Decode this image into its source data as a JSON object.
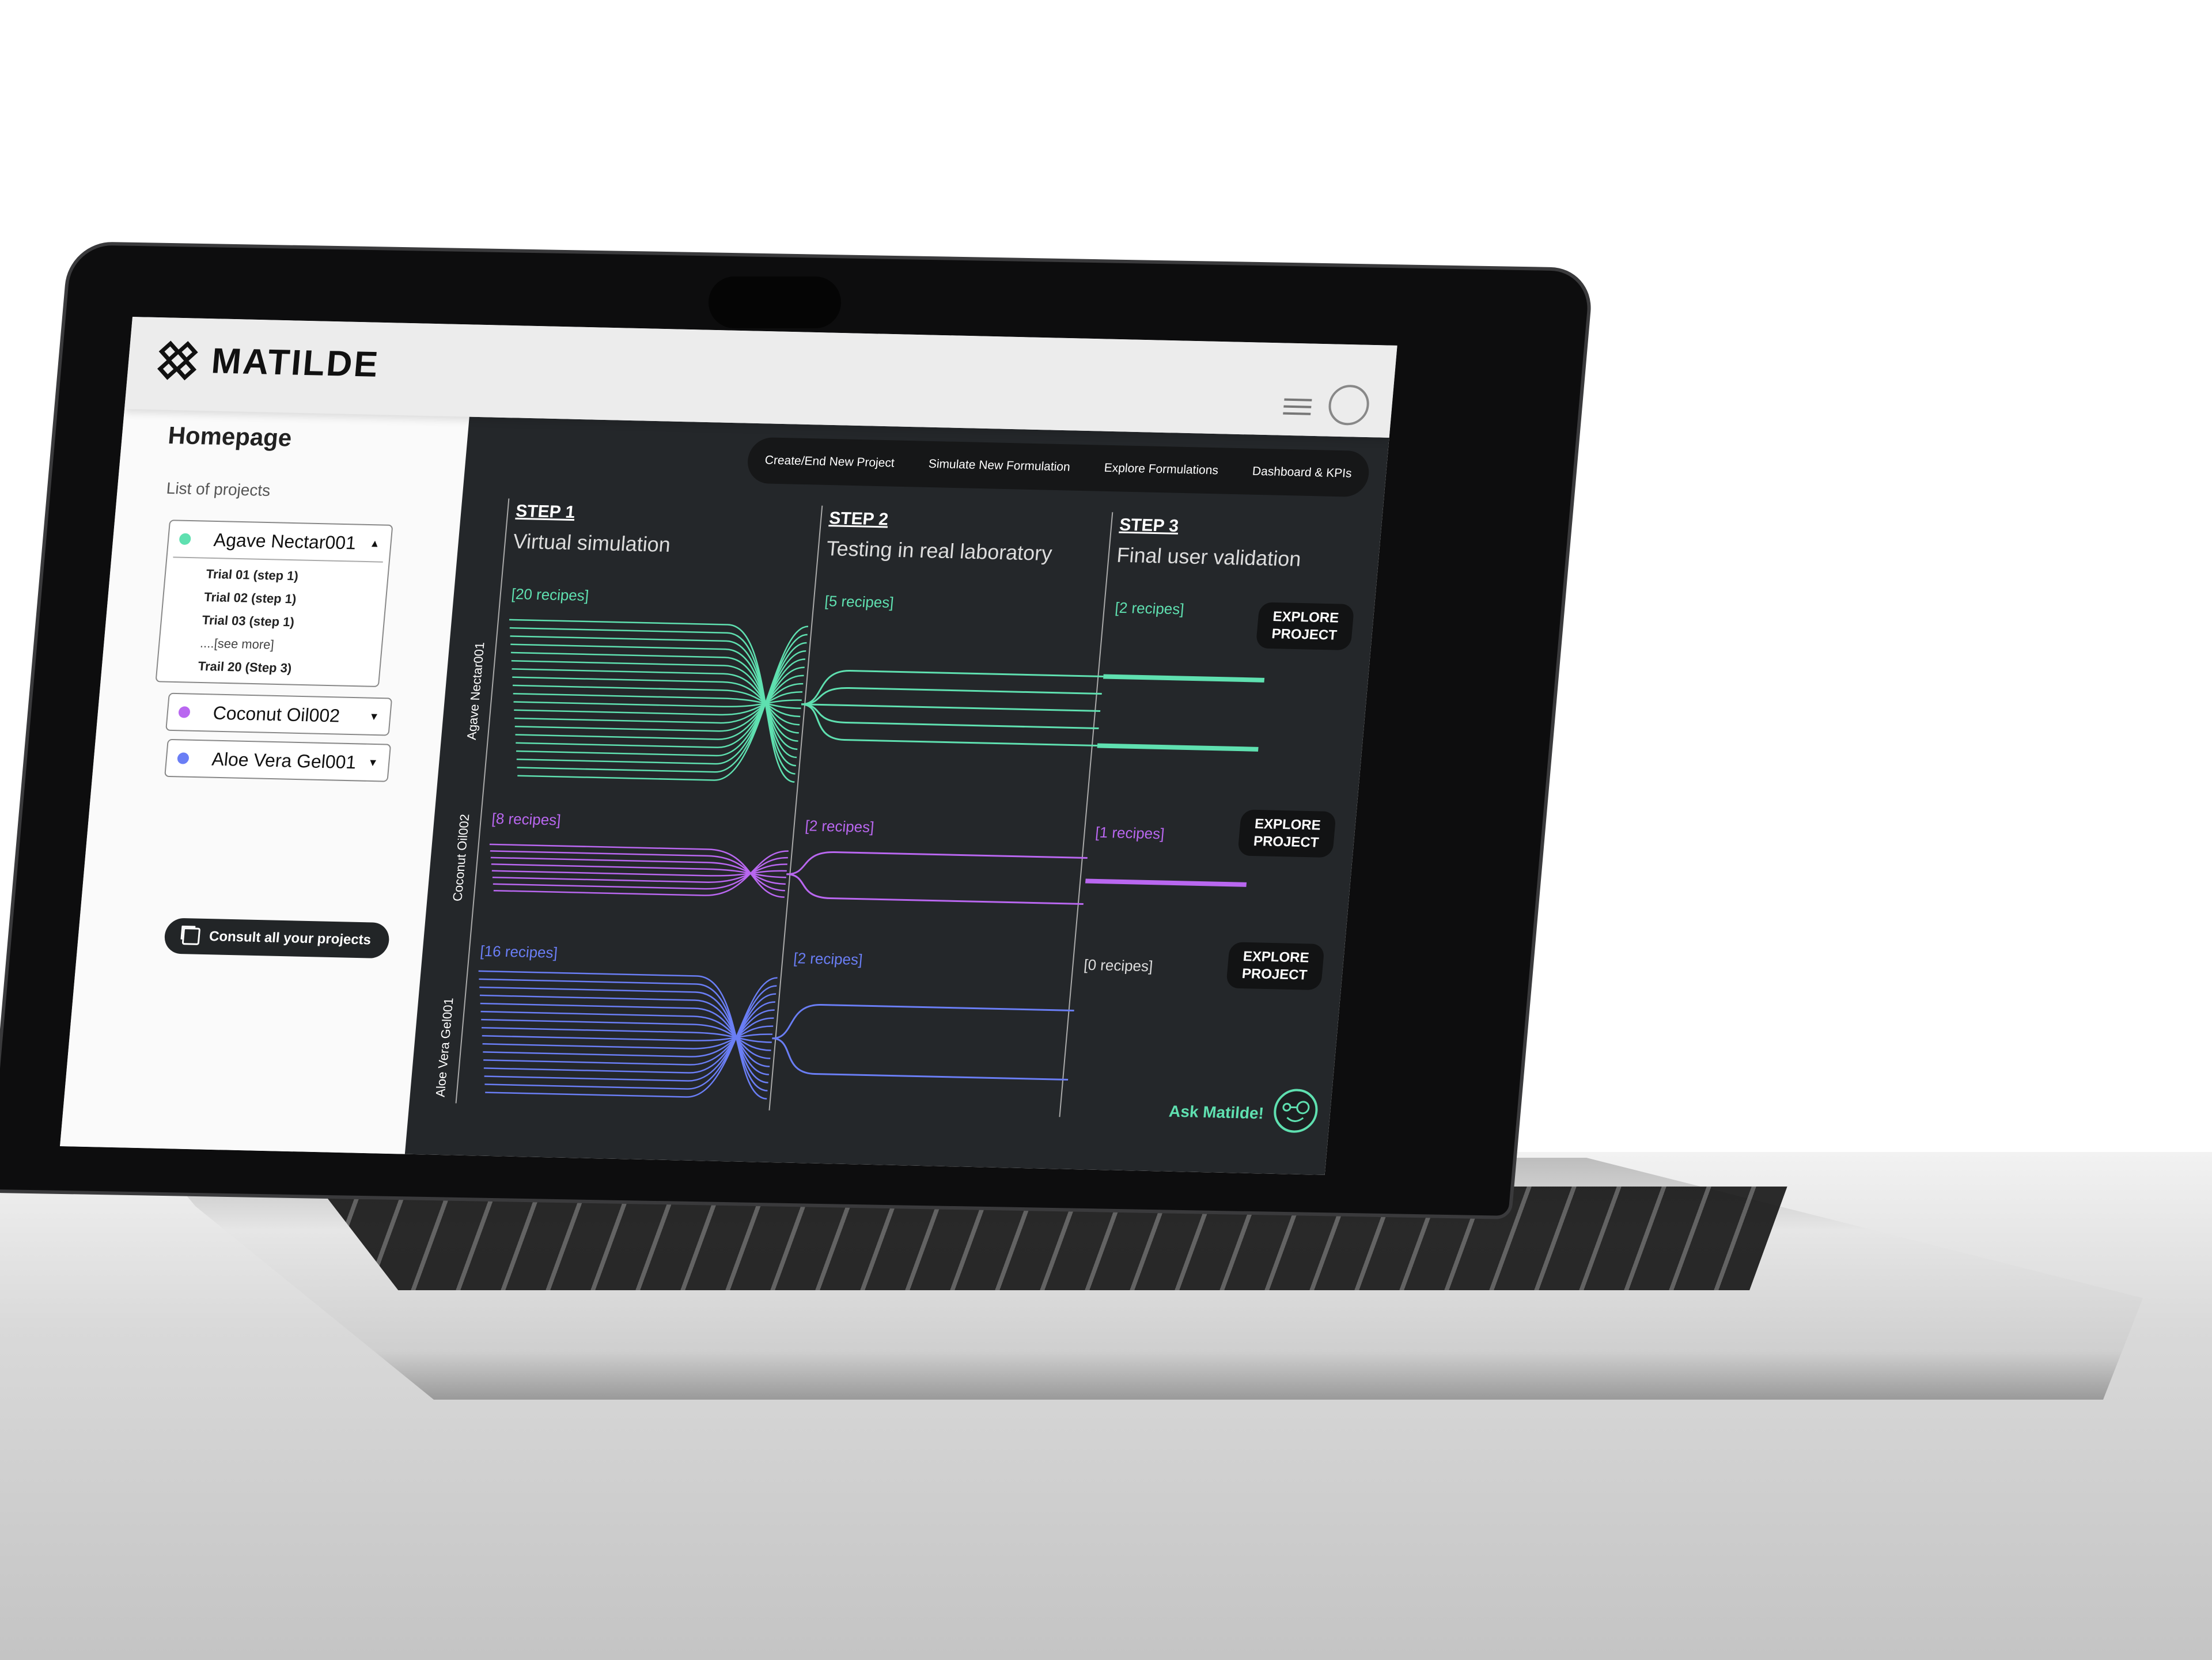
{
  "header": {
    "brand": "MATILDE",
    "icons": [
      "matilde-logo-icon",
      "hamburger-menu-icon",
      "user-profile-icon"
    ]
  },
  "sidebar": {
    "title": "Homepage",
    "list_label": "List of projects",
    "projects": [
      {
        "name": "Agave Nectar001",
        "color": "#5fe0b0",
        "expanded": true,
        "items": [
          "Trial 01 (step 1)",
          "Trial 02 (step 1)",
          "Trial 03 (step 1)",
          "....[see more]",
          "Trail 20 (Step 3)"
        ]
      },
      {
        "name": "Coconut Oil002",
        "color": "#b967f0",
        "expanded": false
      },
      {
        "name": "Aloe Vera Gel001",
        "color": "#6a7ef5",
        "expanded": false
      }
    ],
    "consult_button": "Consult all your projects"
  },
  "nav": [
    "Create/End New Project",
    "Simulate New Formulation",
    "Explore Formulations",
    "Dashboard & KPIs"
  ],
  "steps": [
    {
      "label": "STEP 1",
      "title": "Virtual simulation"
    },
    {
      "label": "STEP 2",
      "title": "Testing in real laboratory"
    },
    {
      "label": "STEP 3",
      "title": "Final user validation"
    }
  ],
  "rows": [
    {
      "project": "Agave Nectar001",
      "color": "#5fe0b0",
      "recipes": [
        20,
        5,
        2
      ],
      "labels": [
        "[20 recipes]",
        "[5 recipes]",
        "[2 recipes]"
      ],
      "explore": "EXPLORE PROJECT"
    },
    {
      "project": "Coconut Oil002",
      "color": "#b967f0",
      "recipes": [
        8,
        2,
        1
      ],
      "labels": [
        "[8 recipes]",
        "[2 recipes]",
        "[1 recipes]"
      ],
      "explore": "EXPLORE PROJECT"
    },
    {
      "project": "Aloe Vera Gel001",
      "color": "#6a7ef5",
      "recipes": [
        16,
        2,
        0
      ],
      "labels": [
        "[16 recipes]",
        "[2 recipes]",
        "[0 recipes]"
      ],
      "explore": "EXPLORE PROJECT"
    }
  ],
  "zero_label_color": "#dddddd",
  "assistant": {
    "label": "Ask Matilde!",
    "icon": "matilde-bot-face-icon"
  }
}
